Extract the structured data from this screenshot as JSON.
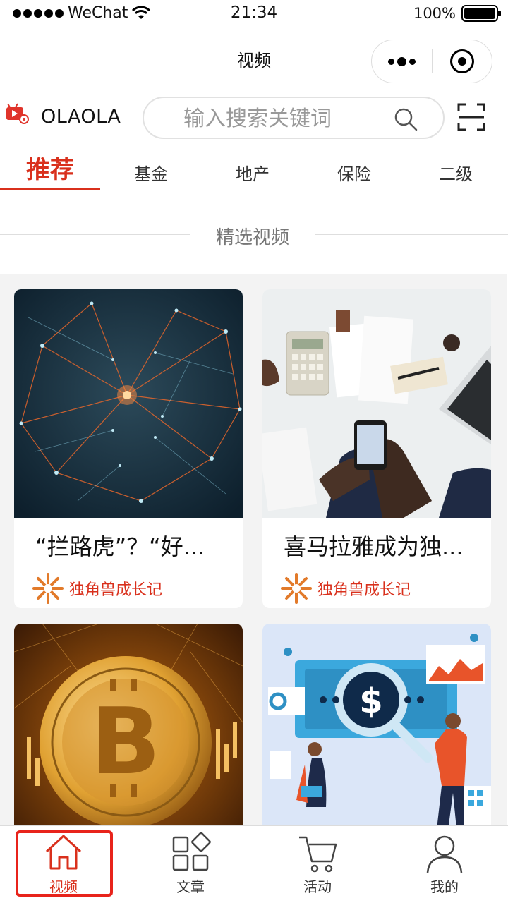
{
  "status_bar": {
    "carrier": "WeChat",
    "time": "21:34",
    "battery": "100%"
  },
  "nav": {
    "title": "视频"
  },
  "brand": {
    "name": "OLAOLA"
  },
  "search": {
    "placeholder": "输入搜索关键词"
  },
  "tabs": [
    {
      "label": "推荐",
      "active": true
    },
    {
      "label": "基金",
      "active": false
    },
    {
      "label": "地产",
      "active": false
    },
    {
      "label": "保险",
      "active": false
    },
    {
      "label": "二级",
      "active": false
    }
  ],
  "section": {
    "title": "精选视频"
  },
  "cards": [
    {
      "title": "“拦路虎”？“好...",
      "author": "独角兽成长记"
    },
    {
      "title": "喜马拉雅成为独...",
      "author": "独角兽成长记"
    },
    {
      "title": "",
      "author": ""
    },
    {
      "title": "",
      "author": ""
    }
  ],
  "tabbar": [
    {
      "label": "视频",
      "icon": "home-icon",
      "active": true
    },
    {
      "label": "文章",
      "icon": "grid-icon",
      "active": false
    },
    {
      "label": "活动",
      "icon": "cart-icon",
      "active": false
    },
    {
      "label": "我的",
      "icon": "user-icon",
      "active": false
    }
  ],
  "colors": {
    "accent": "#d9301c",
    "highlight": "#e8231b"
  }
}
